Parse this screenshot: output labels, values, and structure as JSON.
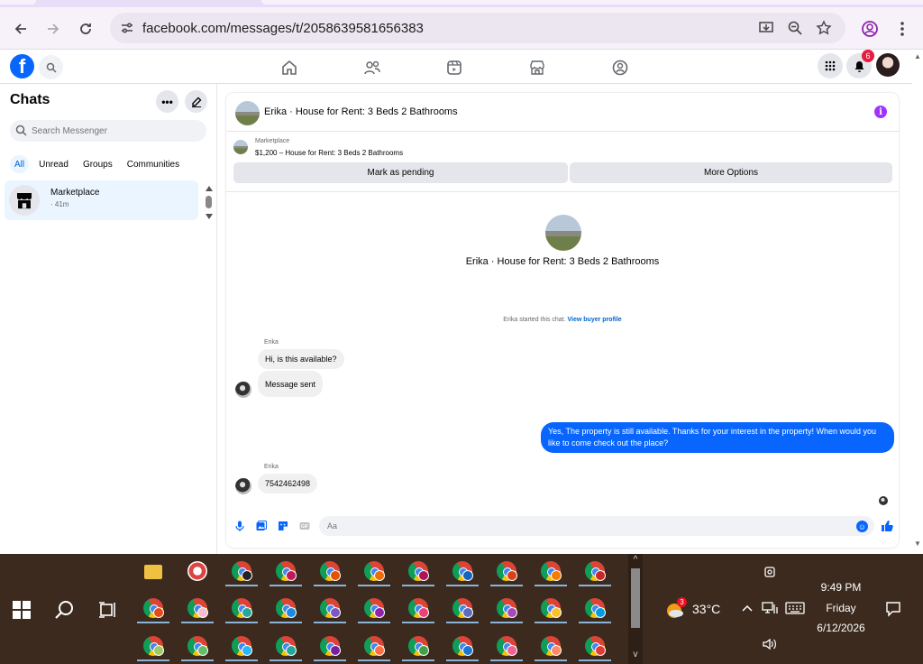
{
  "browser": {
    "url": "facebook.com/messages/t/2058639581656383"
  },
  "header": {
    "notifications_count": "6"
  },
  "sidebar": {
    "title": "Chats",
    "search_placeholder": "Search Messenger",
    "filters": [
      "All",
      "Unread",
      "Groups",
      "Communities"
    ],
    "active_filter": "All",
    "chats": [
      {
        "name": "Marketplace",
        "time": "· 41m"
      }
    ]
  },
  "conversation": {
    "title": "Erika · House for Rent: 3 Beds 2 Bathrooms",
    "listing_source": "Marketplace",
    "listing_price": "$1,200 – House for Rent: 3 Beds 2 Bathrooms",
    "mark_pending_label": "Mark as pending",
    "more_options_label": "More Options",
    "center_title": "Erika · House for Rent: 3 Beds 2 Bathrooms",
    "started_text": "Erika started this chat.",
    "view_buyer_profile": "View buyer profile",
    "messages": [
      {
        "sender": "Erika",
        "text": "Hi, is this available?",
        "direction": "in"
      },
      {
        "text": "Message sent",
        "direction": "in"
      },
      {
        "text": "Yes, The property is still available. Thanks for your interest in the property! When would you like to come check out the place?",
        "direction": "out"
      },
      {
        "sender": "Erika",
        "text": "7542462498",
        "direction": "in"
      }
    ],
    "composer_placeholder": "Aa"
  },
  "taskbar": {
    "temperature": "33°C",
    "weather_badge": "3",
    "time": "9:49 PM",
    "day": "Friday",
    "date": "6/12/2026"
  },
  "colors": {
    "facebook_blue": "#0866ff",
    "info_purple": "#a033ff",
    "taskbar_bg": "#3c2a1e",
    "notif_red": "#e41e3f"
  }
}
